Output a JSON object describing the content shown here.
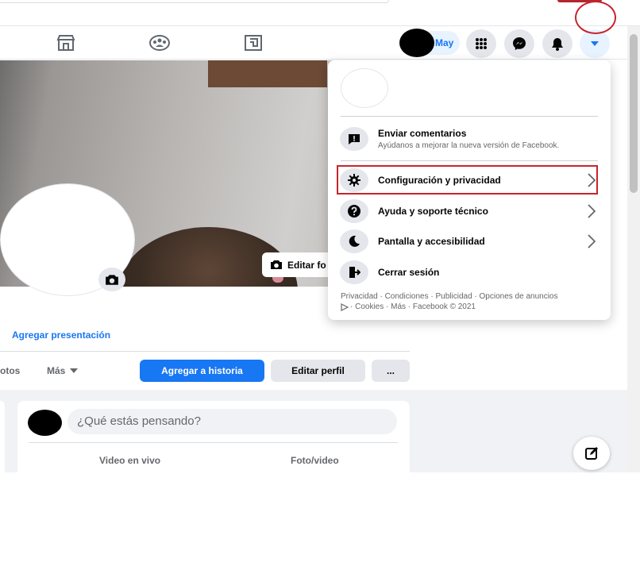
{
  "topbar": {
    "user_name": "May"
  },
  "nav": {
    "icons": [
      "marketplace-icon",
      "groups-icon",
      "gaming-icon"
    ],
    "right_buttons": [
      "menu-grid-icon",
      "messenger-icon",
      "notifications-icon",
      "account-dropdown-icon"
    ]
  },
  "cover": {
    "edit_cover_label": "Editar fo"
  },
  "profile": {
    "add_bio_link": "Agregar presentación",
    "tab_photos_partial": "otos",
    "tab_more": "Más",
    "add_story_button": "Agregar a historia",
    "edit_profile_button": "Editar perfil",
    "more_options_button": "..."
  },
  "composer": {
    "placeholder": "¿Qué estás pensando?",
    "live_video": "Video en vivo",
    "photo_video": "Foto/video"
  },
  "menu": {
    "feedback": {
      "title": "Enviar comentarios",
      "subtitle": "Ayúdanos a mejorar la nueva versión de Facebook."
    },
    "items": [
      {
        "label": "Configuración y privacidad",
        "icon": "gear-icon"
      },
      {
        "label": "Ayuda y soporte técnico",
        "icon": "help-icon"
      },
      {
        "label": "Pantalla y accesibilidad",
        "icon": "moon-icon"
      },
      {
        "label": "Cerrar sesión",
        "icon": "logout-icon"
      }
    ],
    "footer_line1": "Privacidad · Condiciones · Publicidad · Opciones de anuncios",
    "footer_line2": "· Cookies · Más · Facebook © 2021"
  },
  "colors": {
    "brand": "#1877f2",
    "annotation_red": "#c8232c",
    "background": "#f0f2f5"
  }
}
